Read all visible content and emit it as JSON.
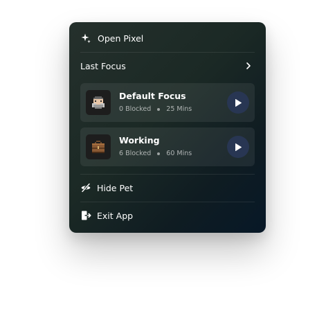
{
  "menu": {
    "open_label": "Open Pixel",
    "open_icon": "sparkle-icon",
    "last_focus_label": "Last Focus",
    "chevron_icon": "chevron-right-icon",
    "focus_items": [
      {
        "title": "Default Focus",
        "blocked": "0 Blocked",
        "duration": "25 Mins",
        "thumb_icon": "pixel-character-icon"
      },
      {
        "title": "Working",
        "blocked": "6 Blocked",
        "duration": "60 Mins",
        "thumb_icon": "briefcase-icon"
      }
    ],
    "hide_pet_label": "Hide Pet",
    "hide_pet_icon": "eye-off-icon",
    "exit_label": "Exit App",
    "exit_icon": "exit-icon"
  },
  "colors": {
    "menu_bg_start": "#25302c",
    "menu_bg_end": "#071827",
    "play_button_bg": "#283653",
    "text": "#ffffff"
  }
}
